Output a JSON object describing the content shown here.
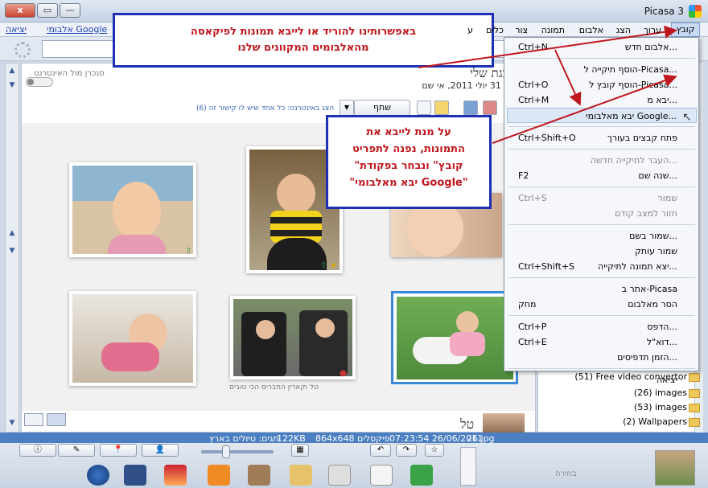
{
  "window": {
    "title": "Picasa 3",
    "close_label": "x",
    "maximize_label": "▭",
    "minimize_label": "—"
  },
  "menubar": {
    "items": [
      "קובץ",
      "ערוך",
      "הצג",
      "אלבום",
      "תמונה",
      "צור",
      "כלים",
      "ע"
    ],
    "link_albums": "אלבומי Google",
    "link_exit": "יציאה"
  },
  "album": {
    "title": "המצגת שלי",
    "date": "יום ראשון 31 יולי 2011, אי שם",
    "share_label": "שתף",
    "share_caption": "הצג באינטרנט: כל אחד שיש לו קישור זה (6)",
    "toggle_label": "סנכרן מול האינטרנט"
  },
  "photos": {
    "caption_3": "טל וקארין החברים הכי טובים"
  },
  "partial_title": "טל",
  "folders": [
    "(51) Free video convertor",
    "(26) images",
    "(53) images",
    "(2) Wallpapers"
  ],
  "status": {
    "filename": "26.jpg",
    "datetime": "07:23:54 26/06/2011",
    "dimensions": "864x648 פיקסלים",
    "size": "122KB",
    "tags": "תגים: טיולים בארץ"
  },
  "tray": {
    "selection_label": "בחירה"
  },
  "file_menu": {
    "items": [
      {
        "label": "אלבום חדש...",
        "shortcut": "Ctrl+N",
        "disabled": false
      },
      {
        "sep": true
      },
      {
        "label": "הוסף תיקייה ל-Picasa...",
        "shortcut": "",
        "disabled": false
      },
      {
        "label": "הוסף קובץ ל-Picasa...",
        "shortcut": "Ctrl+O",
        "disabled": false
      },
      {
        "label": "יבא מ...",
        "shortcut": "Ctrl+M",
        "disabled": false
      },
      {
        "label": "יבא מאלבומי Google...",
        "shortcut": "",
        "disabled": false,
        "highlight": true
      },
      {
        "sep": true
      },
      {
        "label": "פתח קבצים בעורך",
        "shortcut": "Ctrl+Shift+O",
        "disabled": false
      },
      {
        "sep": true
      },
      {
        "label": "העבר לתיקייה חדשה...",
        "shortcut": "",
        "disabled": true
      },
      {
        "label": "שנה שם...",
        "shortcut": "F2",
        "disabled": false
      },
      {
        "sep": true
      },
      {
        "label": "שמור",
        "shortcut": "Ctrl+S",
        "disabled": true
      },
      {
        "label": "חזור למצב קודם",
        "shortcut": "",
        "disabled": true
      },
      {
        "sep": true
      },
      {
        "label": "שמור בשם...",
        "shortcut": "",
        "disabled": false
      },
      {
        "label": "שמור עותק",
        "shortcut": "",
        "disabled": false
      },
      {
        "label": "יצא תמונה לתיקייה...",
        "shortcut": "Ctrl+Shift+S",
        "disabled": false
      },
      {
        "sep": true
      },
      {
        "label": "אתר ב-Picasa",
        "shortcut": "",
        "disabled": false
      },
      {
        "label": "הסר מאלבום",
        "shortcut": "מחק",
        "disabled": false
      },
      {
        "sep": true
      },
      {
        "label": "הדפס...",
        "shortcut": "Ctrl+P",
        "disabled": false
      },
      {
        "label": "דוא\"ל...",
        "shortcut": "Ctrl+E",
        "disabled": false
      },
      {
        "label": "הזמן תדפיסים...",
        "shortcut": "",
        "disabled": false
      },
      {
        "sep": true
      },
      {
        "label": "יציאה",
        "shortcut": "",
        "disabled": false
      }
    ]
  },
  "annotations": {
    "top_line1": "באפשרותינו להוריד או לייבא תמונות לפיקאסה",
    "top_line2": "מהאלבומים המקוונים שלנו",
    "mid_line1": "על מנת לייבא את",
    "mid_line2": "התמונות, נפנה לתפריט",
    "mid_line3": "\"קובץ\" ונבחר בפקודת",
    "mid_line4": "\"יבא מאלבומי Google\""
  },
  "colors": {
    "accent": "#1c2fb5",
    "annotation_text": "#c0161d",
    "status_bar": "#4b7fc1"
  }
}
